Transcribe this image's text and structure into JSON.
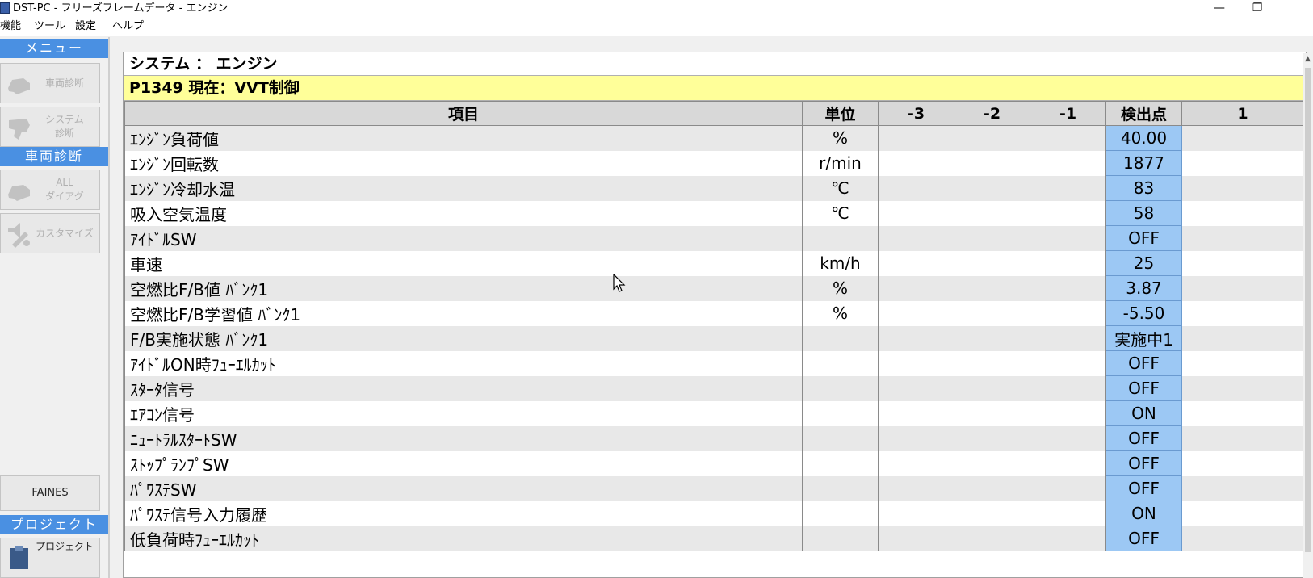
{
  "window": {
    "title": "DST-PC - フリーズフレームデータ - エンジン",
    "minimize_glyph": "—",
    "restore_glyph": "❐"
  },
  "menu": [
    "機能",
    "ツール",
    "設定",
    "ヘルプ"
  ],
  "sidebar": {
    "menu_header": "メニュー",
    "buttons": [
      {
        "label": "車両診断",
        "icon": "car-silhouette-icon"
      },
      {
        "label": "システム\n診断",
        "icon": "engine-icon"
      },
      {
        "label": "ALL\nダイアグ",
        "icon": "car-silhouette-icon"
      },
      {
        "label": "カスタマイズ",
        "icon": "speaker-wrench-icon"
      }
    ],
    "diag_header": "車両診断",
    "faines_label": "FAINES",
    "project_header": "プロジェクト",
    "project_label": "プロジェクト"
  },
  "system_line": "システム ： エンジン",
  "dtc_line": "P1349  現在：VVT制御",
  "table": {
    "headers": [
      "項目",
      "単位",
      "-3",
      "-2",
      "-1",
      "検出点",
      "1"
    ],
    "rows": [
      {
        "item": "ｴﾝｼﾞﾝ負荷値",
        "unit": "%",
        "det": "40.00"
      },
      {
        "item": "ｴﾝｼﾞﾝ回転数",
        "unit": "r/min",
        "det": "1877"
      },
      {
        "item": "ｴﾝｼﾞﾝ冷却水温",
        "unit": "℃",
        "det": "83"
      },
      {
        "item": "吸入空気温度",
        "unit": "℃",
        "det": "58"
      },
      {
        "item": "ｱｲﾄﾞﾙSW",
        "unit": "",
        "det": "OFF"
      },
      {
        "item": "車速",
        "unit": "km/h",
        "det": "25"
      },
      {
        "item": "空燃比F/B値 ﾊﾞﾝｸ1",
        "unit": "%",
        "det": "3.87"
      },
      {
        "item": "空燃比F/B学習値 ﾊﾞﾝｸ1",
        "unit": "%",
        "det": "-5.50"
      },
      {
        "item": "F/B実施状態 ﾊﾞﾝｸ1",
        "unit": "",
        "det": "実施中1"
      },
      {
        "item": "ｱｲﾄﾞﾙON時ﾌｭｰｴﾙｶｯﾄ",
        "unit": "",
        "det": "OFF"
      },
      {
        "item": "ｽﾀｰﾀ信号",
        "unit": "",
        "det": "OFF"
      },
      {
        "item": "ｴｱｺﾝ信号",
        "unit": "",
        "det": "ON"
      },
      {
        "item": "ﾆｭｰﾄﾗﾙｽﾀｰﾄSW",
        "unit": "",
        "det": "OFF"
      },
      {
        "item": "ｽﾄｯﾌﾟﾗﾝﾌﾟSW",
        "unit": "",
        "det": "OFF"
      },
      {
        "item": "ﾊﾟﾜｽﾃSW",
        "unit": "",
        "det": "OFF"
      },
      {
        "item": "ﾊﾟﾜｽﾃ信号入力履歴",
        "unit": "",
        "det": "ON"
      },
      {
        "item": "低負荷時ﾌｭｰｴﾙｶｯﾄ",
        "unit": "",
        "det": "OFF"
      }
    ]
  },
  "colors": {
    "accent": "#4a90e2",
    "dtc_bg": "#ffff99",
    "detect_bg": "#9cc8f4"
  }
}
